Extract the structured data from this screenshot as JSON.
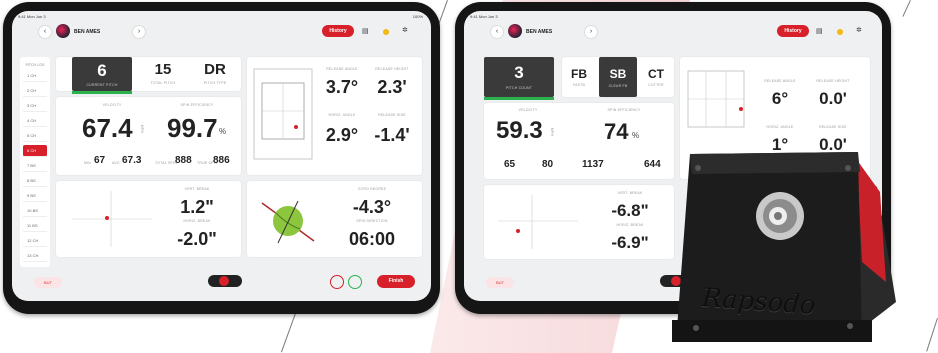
{
  "brand": {
    "accent": "#d7202a",
    "green": "#2bb24c",
    "dark": "#3a3a3a"
  },
  "left": {
    "status_time": "9:41  Mon Jun 3",
    "status_battery": "100%",
    "player_name": "BEN AMES",
    "history_label": "History",
    "pitch_count_label": "PITCH LOG",
    "pitch_list": [
      "1",
      "2",
      "3",
      "4",
      "5",
      "6",
      "7",
      "8",
      "9",
      "10",
      "11",
      "12",
      "13",
      "14"
    ],
    "pitch_types": [
      "CH",
      "CH",
      "CH",
      "CH",
      "CH",
      "CH",
      "CH",
      "BS",
      "BS",
      "BS",
      "BS",
      "BS",
      "CH",
      "CH"
    ],
    "current_pitch": "6",
    "current_pitch_label": "CURRENT PITCH",
    "total_pitch": "15",
    "total_pitch_label": "TOTAL PITCH",
    "pitch_type": "DR",
    "pitch_type_label": "PITCH TYPE",
    "release_angle_label": "RELEASE ANGLE",
    "release_angle": "3.7°",
    "release_height_label": "RELEASE HEIGHT",
    "release_height": "2.3'",
    "horiz_angle_label": "HORIZ. ANGLE",
    "horiz_angle": "2.9°",
    "release_side_label": "RELEASE SIDE",
    "release_side": "-1.4'",
    "velocity_label": "VELOCITY",
    "velocity": "67.4",
    "velocity_unit": "MPH",
    "velo_min_label": "MIN",
    "velo_min": "67",
    "velo_avg_label": "AVG",
    "velo_avg": "67.3",
    "spin_eff_label": "SPIN EFFICIENCY",
    "spin_eff": "99.7",
    "spin_eff_unit": "%",
    "total_spin_label": "TOTAL SPIN",
    "total_spin": "888",
    "true_spin_label": "TRUE SPIN",
    "true_spin": "886",
    "vert_break_label": "VERT. BREAK",
    "vert_break": "1.2\"",
    "horiz_break_label": "HORIZ. BREAK",
    "horiz_break": "-2.0\"",
    "gyro_label": "GYRO DEGREE",
    "gyro": "-4.3°",
    "spin_dir_label": "SPIN DIRECTION",
    "spin_dir": "06:00",
    "finish_label": "Finish",
    "bottom_left_label": "BUT"
  },
  "right": {
    "status_time": "9:41  Mon Jun 3",
    "player_name": "BEN AMES",
    "history_label": "History",
    "pitch_count": "3",
    "pitch_count_label": "PITCH COUNT",
    "type_tabs": [
      "FB",
      "SB",
      "CT"
    ],
    "type_sub": [
      "FASTB",
      "CLEAR FB",
      "CUTTER"
    ],
    "active_tab": "SB",
    "release_angle_label": "RELEASE ANGLE",
    "release_angle": "6°",
    "release_height_label": "RELEASE HEIGHT",
    "release_height": "0.0'",
    "horiz_angle_label": "HORIZ. ANGLE",
    "horiz_angle": "1°",
    "release_side_label": "RELEASE SIDE",
    "release_side": "0.0'",
    "velocity_label": "VELOCITY",
    "velocity": "59.3",
    "velocity_unit": "MPH",
    "velo_min": "65",
    "velo_max": "80",
    "spin_eff_label": "SPIN EFFICIENCY",
    "spin_eff": "74",
    "spin_eff_unit": "%",
    "total_spin": "1137",
    "true_spin": "644",
    "vert_break_label": "VERT. BREAK",
    "vert_break": "-6.8\"",
    "horiz_break_label": "HORIZ. BREAK",
    "horiz_break": "-6.9\"",
    "bottom_left_label": "BUT"
  },
  "device": {
    "brand": "Rapsodo"
  }
}
